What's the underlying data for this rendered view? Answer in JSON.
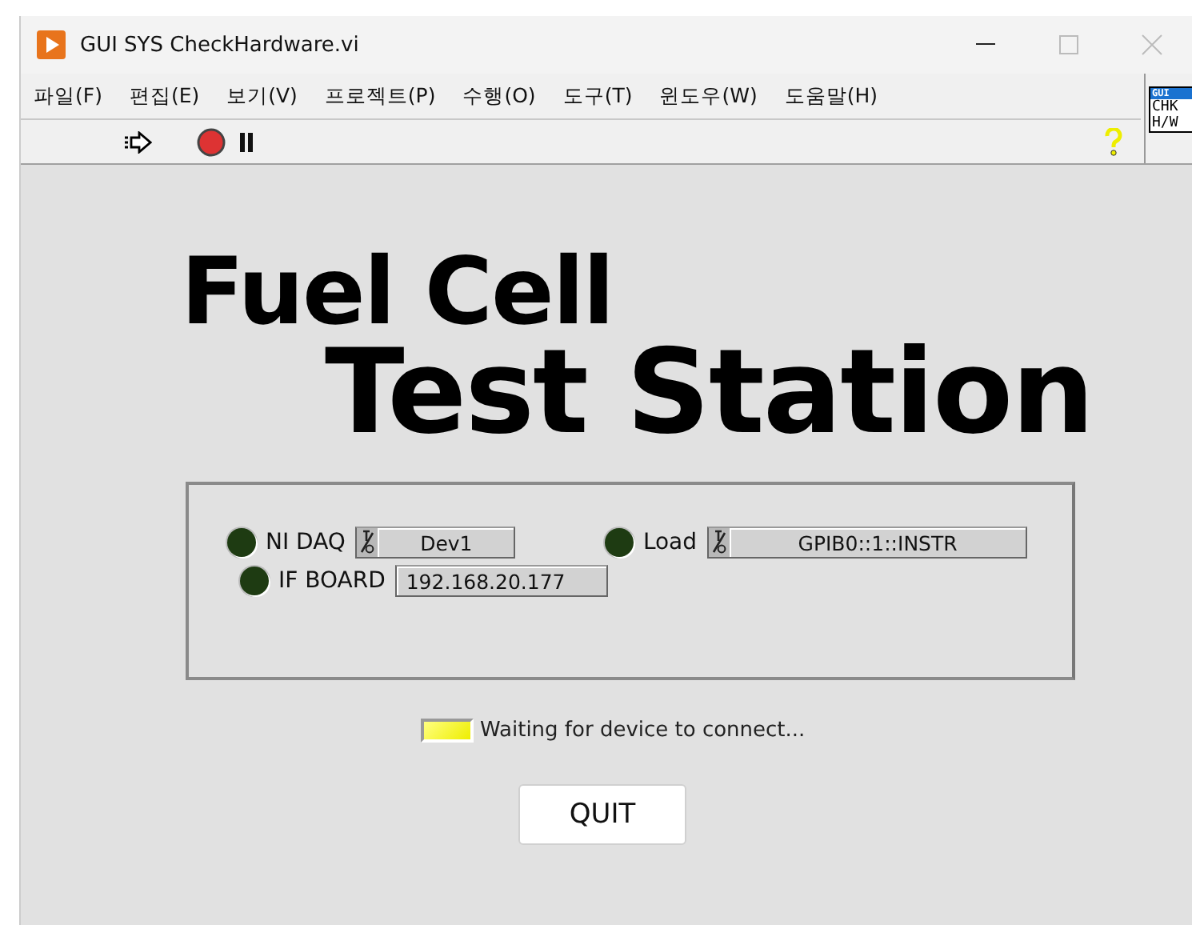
{
  "window": {
    "title": "GUI SYS CheckHardware.vi"
  },
  "menu": [
    "파일(F)",
    "편집(E)",
    "보기(V)",
    "프로젝트(P)",
    "수행(O)",
    "도구(T)",
    "윈도우(W)",
    "도움말(H)"
  ],
  "vi_icon": {
    "header": "GUI",
    "lines": [
      "CHK",
      "H/W"
    ]
  },
  "panel": {
    "title_line_1": "Fuel Cell",
    "title_line_2": "Test Station",
    "devices": [
      {
        "label": "NI DAQ",
        "on": false,
        "value": "Dev1",
        "kind": "io"
      },
      {
        "label": "Load",
        "on": false,
        "value": "GPIB0::1::INSTR",
        "kind": "io"
      },
      {
        "label": "IF BOARD",
        "on": false,
        "value": "192.168.20.177",
        "kind": "text"
      }
    ],
    "status": {
      "on": true,
      "message": "Waiting for device to connect..."
    },
    "quit_button": "QUIT"
  }
}
